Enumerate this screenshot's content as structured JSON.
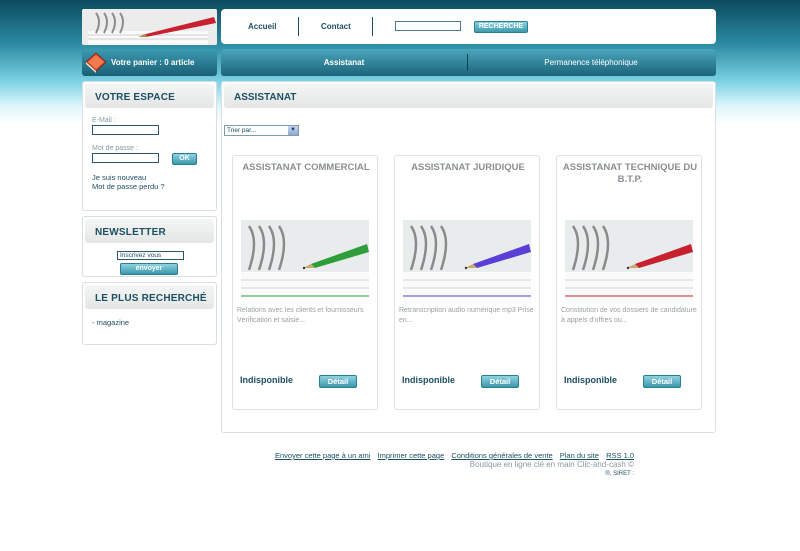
{
  "header": {
    "nav": [
      {
        "label": "Accueil"
      },
      {
        "label": "Contact"
      }
    ],
    "search": {
      "value": "",
      "button_label": "RECHERCHE"
    },
    "cart_label": "Votre panier : 0 article"
  },
  "categories": [
    {
      "label": "Assistanat",
      "active": true
    },
    {
      "label": "Permanence téléphonique",
      "active": false
    }
  ],
  "sidebar": {
    "account": {
      "title": "VOTRE ESPACE",
      "email_label": "E-Mail :",
      "password_label": "Mot de passe :",
      "ok_label": "OK",
      "links": [
        "Je suis nouveau",
        "Mot de passe perdu ?"
      ]
    },
    "newsletter": {
      "title": "NEWSLETTER",
      "input_value": "Inscrivez vous",
      "button_label": "envoyer"
    },
    "popular": {
      "title": "LE PLUS RECHERCHÉ",
      "items": [
        "- magazine"
      ]
    }
  },
  "main": {
    "title": "ASSISTANAT",
    "sort_label": "Trier par...",
    "products": [
      {
        "title": "ASSISTANAT COMMERCIAL",
        "pen_color": "#2e9e3a",
        "description": "Relations avec les clients et fournisseurs Vérification et saisie...",
        "status": "Indisponible",
        "button": "Détail"
      },
      {
        "title": "ASSISTANAT JURIDIQUE",
        "pen_color": "#5a3fd6",
        "description": "Retranscription audio numérique mp3 Prise en...",
        "status": "Indisponible",
        "button": "Détail"
      },
      {
        "title": "ASSISTANAT TECHNIQUE DU B.T.P.",
        "pen_color": "#c8202e",
        "description": "Constitution de vos dossiers de candidature à appels d'offres ou...",
        "status": "Indisponible",
        "button": "Détail"
      }
    ]
  },
  "footer": {
    "links": [
      "Envoyer cette page à un ami",
      "Imprimer cette page",
      "Conditions générales de vente",
      "Plan du site",
      "RSS 1.0"
    ],
    "credit": "Boutique en ligne clé en main Clic-and-cash ©",
    "siret": "®, SIRET :"
  },
  "colors": {
    "accent": "#1d4f63",
    "button": "#3c98ae",
    "pen_header": "#c8202e"
  }
}
